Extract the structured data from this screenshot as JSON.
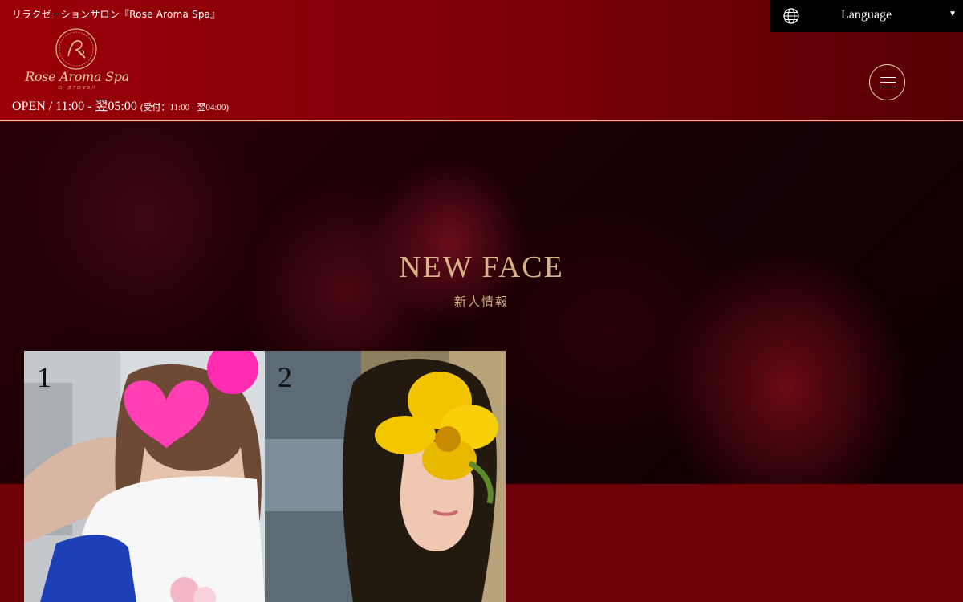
{
  "header": {
    "tagline": "リラクゼーションサロン『Rose Aroma Spa』",
    "logo_text": "Rose Aroma Spa",
    "logo_kana": "ローズアロマスパ",
    "hours_main": "OPEN / 11:00 - 翌05:00",
    "hours_sub": "(受付：11:00 - 翌04:00)"
  },
  "language": {
    "label": "Language",
    "caret": "▼",
    "icon": "globe-icon"
  },
  "menu": {
    "icon": "hamburger-icon"
  },
  "section": {
    "title": "NEW FACE",
    "subtitle": "新人情報"
  },
  "cards": [
    {
      "rank": "1"
    },
    {
      "rank": "2"
    }
  ],
  "colors": {
    "header_red": "#9c0008",
    "gold": "#d8b186",
    "language_bg": "#000000"
  }
}
